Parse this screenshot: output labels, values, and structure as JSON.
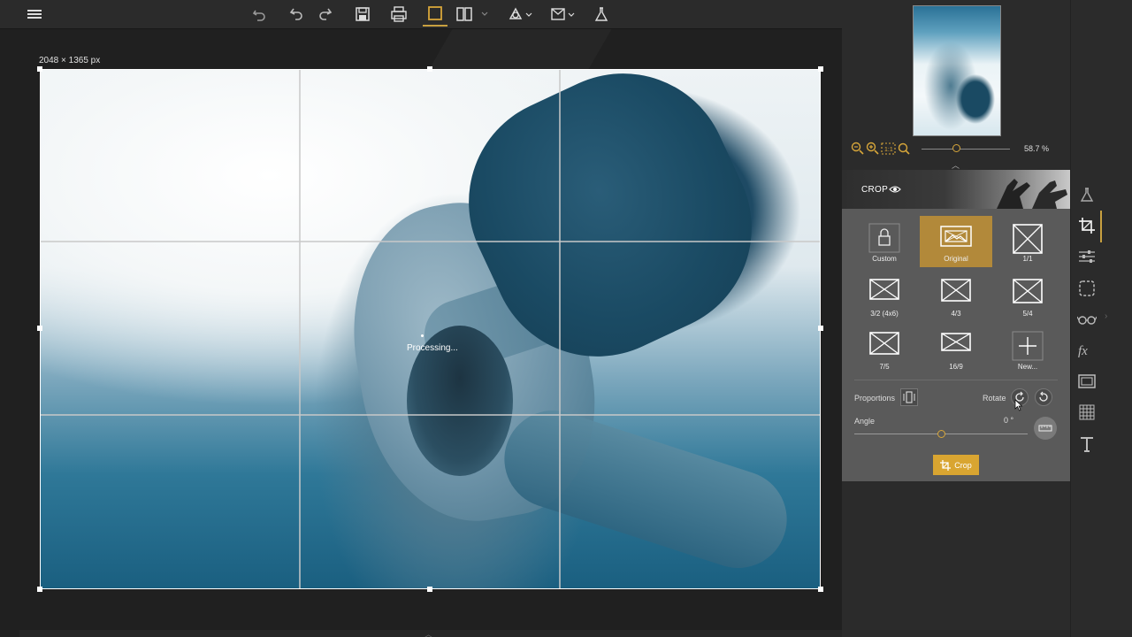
{
  "toolbar": {
    "items": [
      "menu-icon",
      "undo-icon",
      "undo-step-icon",
      "redo-icon",
      "save-icon",
      "print-icon",
      "single-view-icon",
      "compare-view-icon",
      "dropdown-icon",
      "share-icon",
      "export-icon",
      "lab-icon"
    ],
    "accent": "#c8a040"
  },
  "canvas": {
    "dimensions": "2048 × 1365 px",
    "processing": "Processing..."
  },
  "panel": {
    "zoom_percent": "58.7 %",
    "crop_title": "CROP",
    "presets": [
      {
        "label": "Custom",
        "icon": "lock-icon",
        "selected": false
      },
      {
        "label": "Original",
        "icon": "image-icon",
        "selected": true
      },
      {
        "label": "1/1",
        "icon": "ratio-icon",
        "selected": false
      },
      {
        "label": "3/2 (4x6)",
        "icon": "ratio-icon",
        "selected": false
      },
      {
        "label": "4/3",
        "icon": "ratio-icon",
        "selected": false
      },
      {
        "label": "5/4",
        "icon": "ratio-icon",
        "selected": false
      },
      {
        "label": "7/5",
        "icon": "ratio-icon",
        "selected": false
      },
      {
        "label": "16/9",
        "icon": "ratio-icon",
        "selected": false
      },
      {
        "label": "New...",
        "icon": "plus-icon",
        "selected": false
      }
    ],
    "proportions_label": "Proportions",
    "rotate_label": "Rotate",
    "angle_label": "Angle",
    "angle_value": "0 °",
    "crop_button": "Crop",
    "accent": "#d9a531"
  },
  "tools": [
    "lab-icon",
    "crop-icon",
    "adjust-icon",
    "selection-icon",
    "glasses-icon",
    "fx-icon",
    "frame-icon",
    "grid-icon",
    "text-icon"
  ]
}
